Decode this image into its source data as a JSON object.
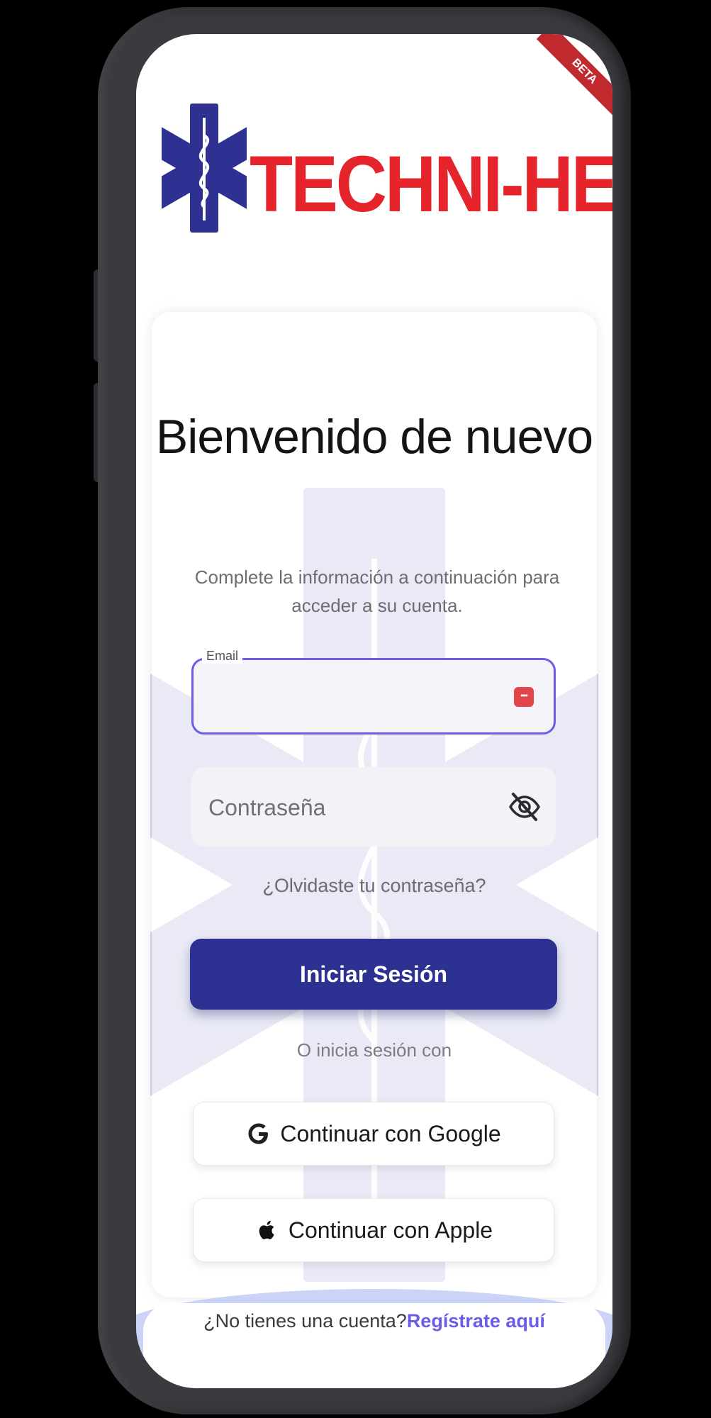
{
  "app": {
    "logo_text": "TECHNI-HELP",
    "corner_badge": "BETA"
  },
  "login": {
    "title": "Bienvenido de nuevo",
    "subtitle": "Complete la información a continuación para acceder a su cuenta.",
    "email": {
      "label": "Email",
      "value": ""
    },
    "password": {
      "placeholder": "Contraseña",
      "value": ""
    },
    "forgot_password": "¿Olvidaste tu contraseña?",
    "submit_label": "Iniciar Sesión",
    "alt_login_text": "O inicia sesión con",
    "google_label": "Continuar con Google",
    "apple_label": "Continuar con Apple",
    "no_account_text": "¿No tienes una cuenta?",
    "register_link": "Regístrate aquí"
  },
  "icons": {
    "logo": "star-of-life-icon",
    "password_manager": "password-key-icon",
    "visibility": "eye-off-icon",
    "google": "google-icon",
    "apple": "apple-icon"
  },
  "colors": {
    "brand_red": "#e5242b",
    "brand_blue": "#2d3192",
    "accent_purple": "#6c5ce7",
    "star_blue": "#2e3192"
  }
}
